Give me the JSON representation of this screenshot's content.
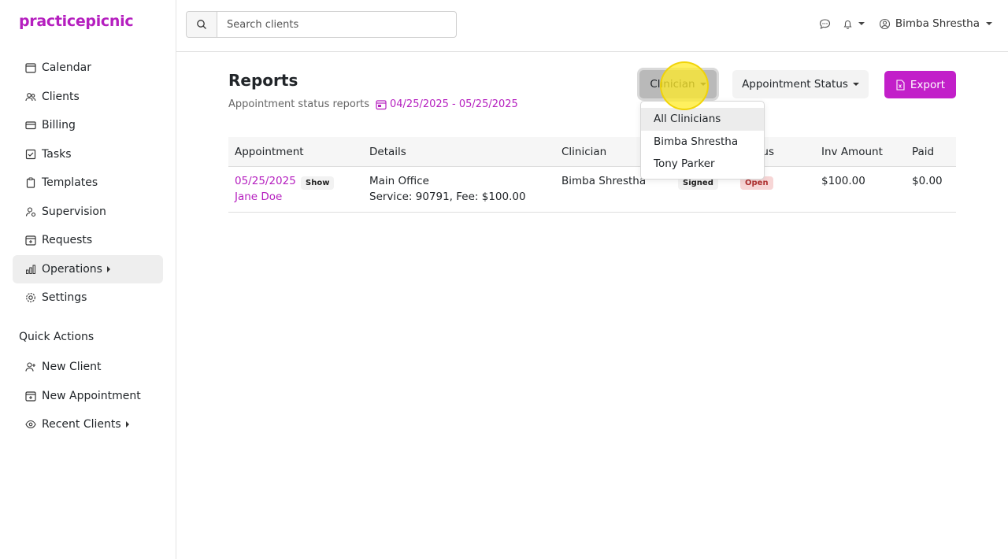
{
  "app": {
    "logo": "practicepicnic",
    "brand_color": "#b51fbf"
  },
  "sidebar": {
    "items": [
      {
        "label": "Calendar",
        "icon": "calendar-icon"
      },
      {
        "label": "Clients",
        "icon": "users-icon"
      },
      {
        "label": "Billing",
        "icon": "credit-card-icon"
      },
      {
        "label": "Tasks",
        "icon": "checkbox-icon"
      },
      {
        "label": "Templates",
        "icon": "clipboard-icon"
      },
      {
        "label": "Supervision",
        "icon": "user-gear-icon"
      },
      {
        "label": "Requests",
        "icon": "calendar-plus-icon"
      },
      {
        "label": "Operations",
        "icon": "bar-chart-icon",
        "active": true
      },
      {
        "label": "Settings",
        "icon": "gear-icon"
      }
    ],
    "quick_actions_title": "Quick Actions",
    "quick_actions": [
      {
        "label": "New Client",
        "icon": "user-plus-icon"
      },
      {
        "label": "New Appointment",
        "icon": "calendar-plus-icon"
      },
      {
        "label": "Recent Clients",
        "icon": "eye-icon"
      }
    ]
  },
  "header": {
    "search_placeholder": "Search clients",
    "user_name": "Bimba Shrestha"
  },
  "main": {
    "title": "Reports",
    "subtitle": "Appointment status reports",
    "date_range": "04/25/2025 - 05/25/2025",
    "filters": {
      "clinician_label": "Clinician",
      "status_label": "Appointment Status",
      "export_label": "Export"
    },
    "clinician_dropdown": [
      "All Clinicians",
      "Bimba Shrestha",
      "Tony Parker"
    ],
    "table": {
      "headers": [
        "Appointment",
        "Details",
        "Clinician",
        "Status",
        "Inv Amount",
        "Paid"
      ],
      "rows": [
        {
          "date": "05/25/2025",
          "client": "Jane Doe",
          "attendance": "Show",
          "location": "Main Office",
          "service": "Service: 90791, Fee: $100.00",
          "clinician": "Bimba Shrestha",
          "note_status": "Signed",
          "invoice_status": "Open",
          "inv_amount": "$100.00",
          "paid": "$0.00"
        }
      ]
    }
  }
}
